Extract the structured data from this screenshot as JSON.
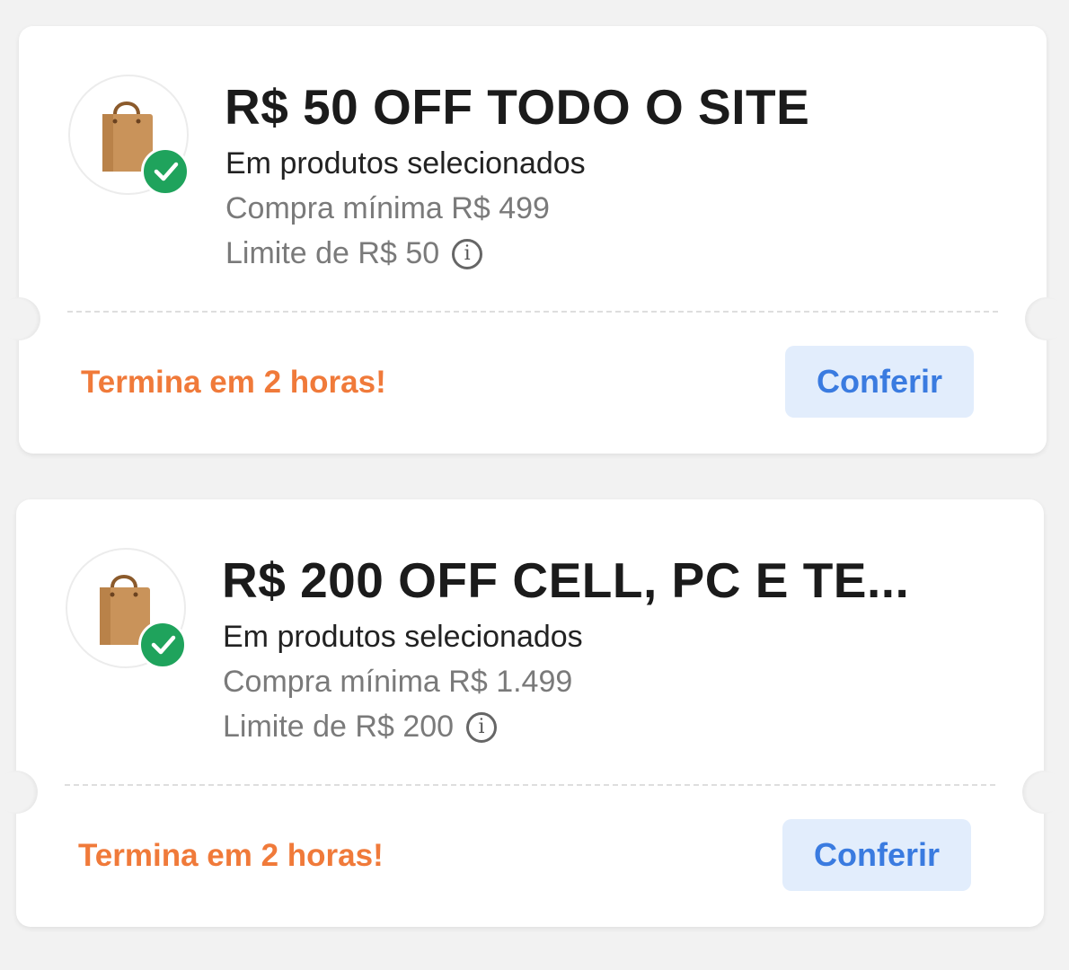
{
  "colors": {
    "page_background": "#f2f2f2",
    "expiry_text": "#f07a3a",
    "button_text": "#3a7be0",
    "button_background": "#e2edfc",
    "check_badge": "#1fa35c"
  },
  "coupons": [
    {
      "icon": "shopping-bag-icon",
      "badge_icon": "check-icon",
      "title": "R$ 50 OFF TODO O SITE",
      "subtitle": "Em produtos selecionados",
      "min_purchase": "Compra mínima R$ 499",
      "limit": "Limite de R$ 50",
      "info_glyph": "i",
      "expiry": "Termina em 2 horas!",
      "button_label": "Conferir"
    },
    {
      "icon": "shopping-bag-icon",
      "badge_icon": "check-icon",
      "title": "R$ 200 OFF CELL, PC E TE...",
      "subtitle": "Em produtos selecionados",
      "min_purchase": "Compra mínima R$ 1.499",
      "limit": "Limite de R$ 200",
      "info_glyph": "i",
      "expiry": "Termina em 2 horas!",
      "button_label": "Conferir"
    }
  ]
}
